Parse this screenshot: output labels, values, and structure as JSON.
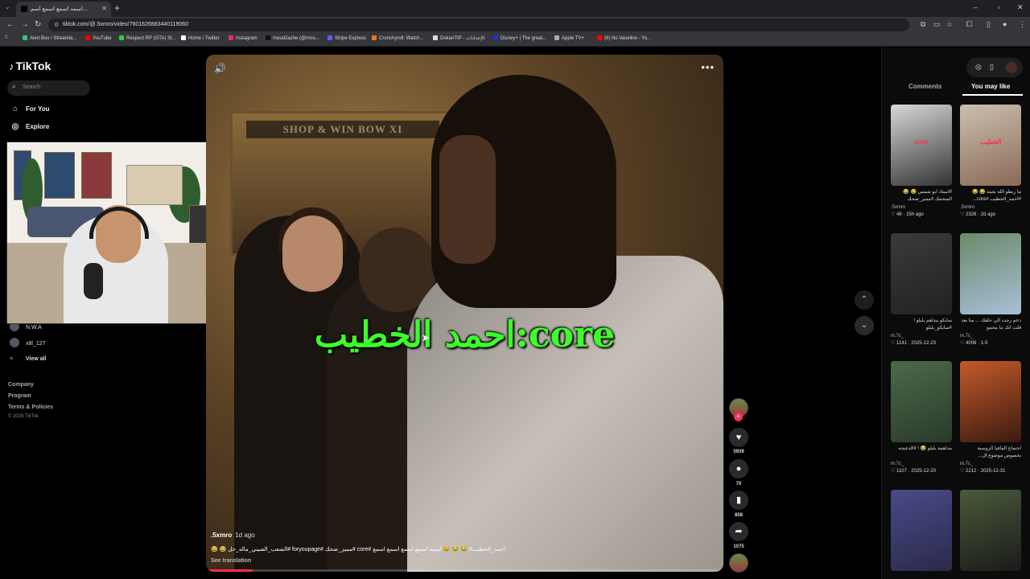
{
  "browser": {
    "tab_title": "اسمه اسمع اسمع اسم...",
    "url": "tiktok.com/@.5xmro/video/7601626883440119060",
    "bookmarks": [
      {
        "label": "Alert Box / Streamla...",
        "color": "#31c47e"
      },
      {
        "label": "YouTube",
        "color": "#ff0000"
      },
      {
        "label": "Respect RP (GTA) St...",
        "color": "#2ecc40"
      },
      {
        "label": "Home / Twitter",
        "color": "#ffffff"
      },
      {
        "label": "Instagram",
        "color": "#e1306c"
      },
      {
        "label": "moud2ache (@mou...",
        "color": "#111111"
      },
      {
        "label": "Stripe Express",
        "color": "#635bff"
      },
      {
        "label": "Crunchyroll: Watch...",
        "color": "#f47521"
      },
      {
        "label": "DokanTIP - الإعدادات",
        "color": "#dddddd"
      },
      {
        "label": "Disney+ | The great...",
        "color": "#113ccf"
      },
      {
        "label": "Apple TV+",
        "color": "#aaaaaa"
      },
      {
        "label": "(6) No Vaseline - Yo...",
        "color": "#ff0000"
      }
    ]
  },
  "sidebar": {
    "logo": "TikTok",
    "search_placeholder": "Search",
    "nav": [
      {
        "label": "For You",
        "icon": "home-icon"
      },
      {
        "label": "Explore",
        "icon": "compass-icon"
      }
    ],
    "following": [
      {
        "name": "N.W.A"
      },
      {
        "name": "x8l_127"
      }
    ],
    "view_all": "View all",
    "footer": [
      "Company",
      "Program",
      "Terms & Policies"
    ],
    "copyright": "© 2026 TikTok"
  },
  "video": {
    "store_sign": "SHOP & WIN BOW XI",
    "caption_overlay": "احمد الخطيب:core",
    "author": ".5xmro",
    "time_ago": "1d ago",
    "description": "😂 😂 الشعب_الصيني_ماله_حل# foryoupage# مميز_ضحك# core# احمد_الخطيب# 😂 😂 😂 اسمه اسمع اسمع اسمع اسمع",
    "see_translation": "See translation",
    "progress": 0.09,
    "likes": "5939",
    "comments": "70",
    "saves": "858",
    "shares": "1075"
  },
  "right_panel": {
    "tabs": [
      "Comments",
      "You may like"
    ],
    "active_tab": "You may like",
    "cards": [
      {
        "title": "الاستاذ ابو شمس 😂 😂 المتحمك #مميز_ضحك",
        "user": ".5xmro",
        "likes": "48",
        "date": "15h ago",
        "bg": "#d8d8d8",
        "overlay": "core",
        "accent": "#333333"
      },
      {
        "title": "ما ربطو الله يعينه 😂 😂 #احمد_الخطيب #core...",
        "user": ".5xmro",
        "likes": "2328",
        "date": "2d ago",
        "bg": "#cbbfb0",
        "overlay": "الخطيب",
        "accent": "#8a6a55"
      },
      {
        "title": "سايكو بيداهم بلبلو ! #سايكو_بلبلو",
        "user": "m.7c_",
        "likes": "1141",
        "date": "2025-12-23",
        "bg": "#3a3a3a",
        "overlay": "",
        "accent": "#222222"
      },
      {
        "title": "دعم رحت الي خلقك ... منا بعد قلت انك ما محمو",
        "user": "m.7c_",
        "likes": "4006",
        "date": "1-5",
        "bg": "#6a8a6a",
        "overlay": "",
        "accent": "#a8c0d8"
      },
      {
        "title": "مداهمة بلبلو 😂 ! #الدعيجه",
        "user": "m.7c_",
        "likes": "1107",
        "date": "2025-12-20",
        "bg": "#4a6a4a",
        "overlay": "",
        "accent": "#2a3a2a"
      },
      {
        "title": "اجتماع المافيا الروسية بخصوص موضوع ال...",
        "user": "m.7c_",
        "likes": "2212",
        "date": "2025-12-31",
        "bg": "#c45a2a",
        "overlay": "",
        "accent": "#3a1a10"
      },
      {
        "title": "",
        "user": "",
        "likes": "",
        "date": "",
        "bg": "#4a4a8a",
        "overlay": "",
        "accent": "#2a2a4a"
      },
      {
        "title": "",
        "user": "",
        "likes": "",
        "date": "",
        "bg": "#4a5a3a",
        "overlay": "",
        "accent": "#1a1a1a"
      }
    ]
  },
  "colors": {
    "accent": "#fe2c55",
    "caption": "#3cff2a"
  }
}
